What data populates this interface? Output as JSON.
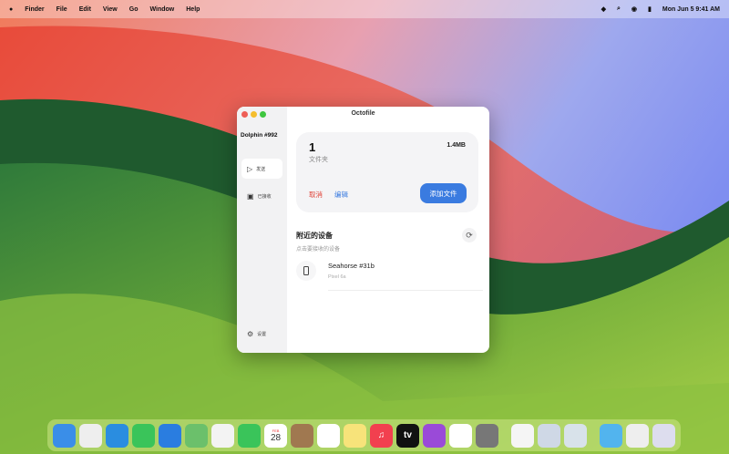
{
  "menubar": {
    "apple": "",
    "items": [
      "Finder",
      "File",
      "Edit",
      "View",
      "Go",
      "Window",
      "Help"
    ],
    "clock": "Mon Jun 5  9:41 AM",
    "status_icons": [
      "wifi-icon",
      "search-icon",
      "control-center-icon",
      "battery-icon"
    ]
  },
  "window": {
    "title": "Octofile",
    "sidebar": {
      "device_name": "Dolphin #992",
      "items": [
        {
          "label": "发送",
          "icon": "send-icon"
        },
        {
          "label": "已接收",
          "icon": "inbox-icon"
        }
      ],
      "settings_label": "设置"
    },
    "selection": {
      "count": "1",
      "type": "文件夹",
      "size": "1.4MB",
      "cancel": "取消",
      "edit": "编辑",
      "add_files": "添加文件"
    },
    "nearby": {
      "title": "附近的设备",
      "subtitle": "点击要接收的设备",
      "devices": [
        {
          "name": "Seahorse #31b",
          "model": "Pixel 6a"
        }
      ]
    }
  },
  "colors": {
    "accent": "#3a7be0",
    "danger": "#e0443a"
  },
  "dock": {
    "apps": [
      {
        "name": "finder",
        "color": "#3a8ee8"
      },
      {
        "name": "launchpad",
        "color": "#eee"
      },
      {
        "name": "safari",
        "color": "#2a8de0"
      },
      {
        "name": "messages",
        "color": "#3ac45a"
      },
      {
        "name": "mail",
        "color": "#2a7de0"
      },
      {
        "name": "maps",
        "color": "#6bc06b"
      },
      {
        "name": "photos",
        "color": "#f3f3f3"
      },
      {
        "name": "facetime",
        "color": "#3ac45a"
      },
      {
        "name": "calendar",
        "color": "#fff",
        "text": "28",
        "top": "FEB"
      },
      {
        "name": "contacts",
        "color": "#a07850"
      },
      {
        "name": "reminders",
        "color": "#fff"
      },
      {
        "name": "notes",
        "color": "#f7e37a"
      },
      {
        "name": "music",
        "color": "#f2404f",
        "text": "♫"
      },
      {
        "name": "tv",
        "color": "#111",
        "text": "tv"
      },
      {
        "name": "podcasts",
        "color": "#9a4ad8"
      },
      {
        "name": "news",
        "color": "#fff"
      },
      {
        "name": "system-settings",
        "color": "#777"
      },
      {
        "name": "textedit",
        "color": "#f5f5f5"
      },
      {
        "name": "preview",
        "color": "#cfd8e6"
      },
      {
        "name": "window",
        "color": "#d8e2ea"
      },
      {
        "name": "downloads-folder",
        "color": "#52b4ee"
      },
      {
        "name": "documents",
        "color": "#eee"
      },
      {
        "name": "trash",
        "color": "#dde"
      }
    ]
  }
}
